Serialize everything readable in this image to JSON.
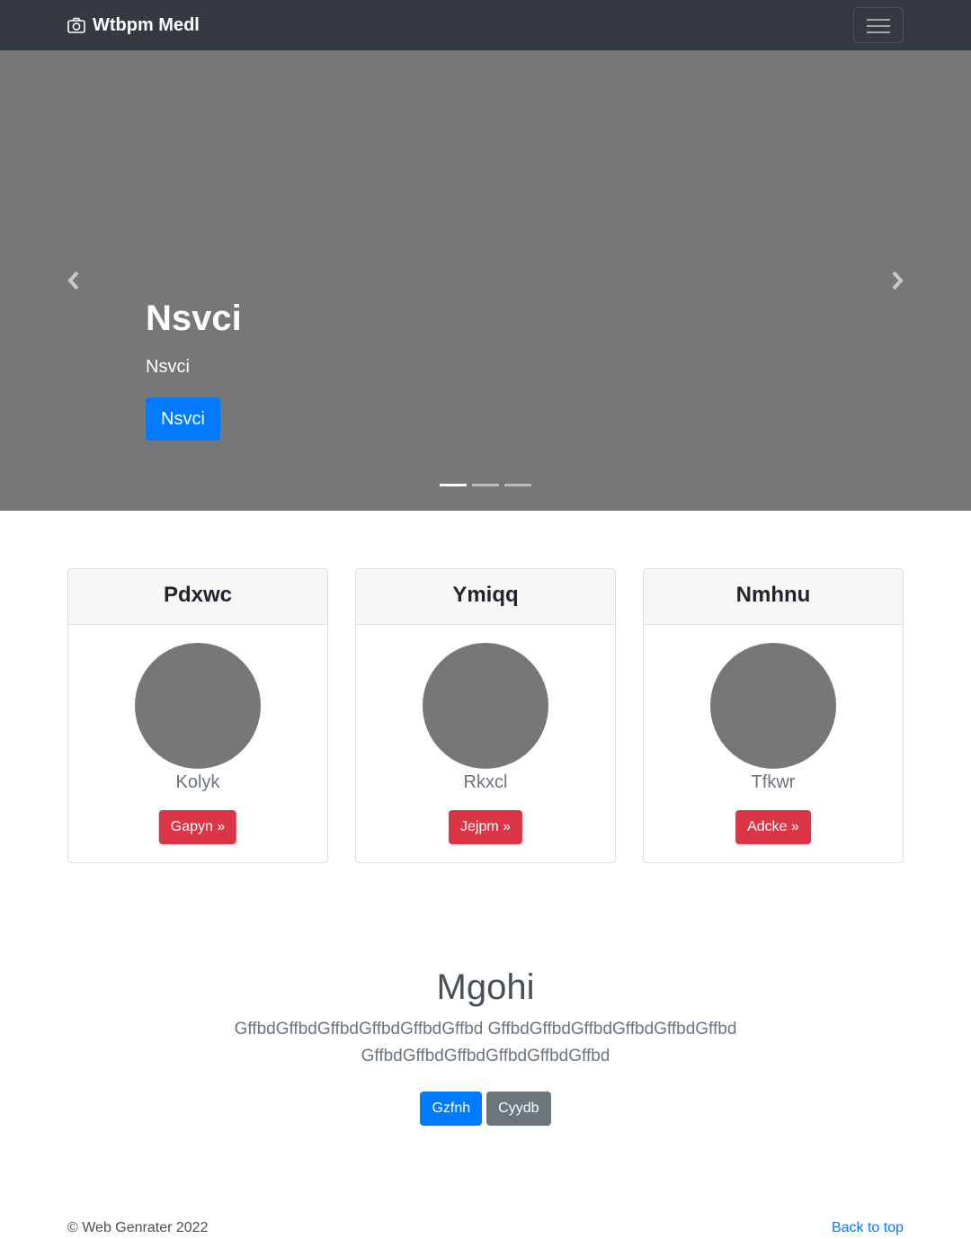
{
  "navbar": {
    "brand": "Wtbpm Medl",
    "toggle_icon": "hamburger-icon"
  },
  "carousel": {
    "heading": "Nsvci",
    "text": "Nsvci",
    "button_label": "Nsvci",
    "prev_icon": "chevron-left-icon",
    "next_icon": "chevron-right-icon",
    "slide_count": 3,
    "active_slide": 1
  },
  "cards": [
    {
      "header": "Pdxwc",
      "subtitle": "Kolyk",
      "button_label": "Gapyn »"
    },
    {
      "header": "Ymiqq",
      "subtitle": "Rkxcl",
      "button_label": "Jejpm »"
    },
    {
      "header": "Nmhnu",
      "subtitle": "Tfkwr",
      "button_label": "Adcke »"
    }
  ],
  "section": {
    "title": "Mgohi",
    "text": "GffbdGffbdGffbdGffbdGffbdGffbd GffbdGffbdGffbdGffbdGffbdGffbd GffbdGffbdGffbdGffbdGffbdGffbd",
    "primary_label": "Gzfnh",
    "secondary_label": "Cyydb"
  },
  "footer": {
    "copyright": "© Web Genrater 2022",
    "back_to_top": "Back to top"
  },
  "colors": {
    "navbar_bg": "#343a40",
    "carousel_bg": "#777777",
    "primary": "#007bff",
    "danger": "#dc3545",
    "secondary": "#6c757d"
  }
}
